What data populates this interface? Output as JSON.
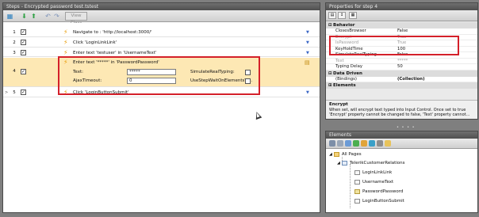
{
  "steps_panel": {
    "title": "Steps - Encrypted password test.tstest",
    "toolbar": {
      "view_class_label": "View Class"
    },
    "rows": [
      {
        "num": "1",
        "desc": "Navigate to : 'http://localhost:3000/'"
      },
      {
        "num": "2",
        "desc": "Click 'LoginLinkLink'"
      },
      {
        "num": "3",
        "desc": "Enter text 'testuser' in 'UsernameText'"
      },
      {
        "num": "4",
        "desc": "Enter text '*****' in 'PasswordPassword'"
      },
      {
        "num": "5",
        "desc": "Click 'LoginButtonSubmit'"
      }
    ],
    "expanded": {
      "text_label": "Text:",
      "text_value": "*****",
      "ajax_label": "AjaxTimeout:",
      "ajax_value": "0",
      "simulate_label": "SimulateRealTyping:",
      "use_step_label": "UseStepWaitOnElementsTi..."
    }
  },
  "properties_panel": {
    "title": "Properties for step 4",
    "categories": {
      "behavior": "Behavior",
      "data_driven": "Data Driven",
      "elements": "Elements"
    },
    "behavior_rows": [
      {
        "name": "ClosesBrowser",
        "value": "False",
        "dim": false
      },
      {
        "name": "Encrypt",
        "value": "True",
        "dim": true
      },
      {
        "name": "IsPassword",
        "value": "True",
        "dim": true
      },
      {
        "name": "KeyHoldTime",
        "value": "100",
        "dim": false
      },
      {
        "name": "SimulateRealTyping",
        "value": "False",
        "dim": false
      },
      {
        "name": "Text",
        "value": "*****",
        "dim": true
      },
      {
        "name": "Typing Delay",
        "value": "50",
        "dim": false
      }
    ],
    "data_driven_rows": [
      {
        "name": "(Bindings)",
        "value": "(Collection)"
      }
    ],
    "description_title": "Encrypt",
    "description_text": "When set, will encrypt text typed into Input Control. Once set to true 'Encrypt' property cannot be changed to false, 'Text' property cannot..."
  },
  "elements_panel": {
    "title": "Elements",
    "tree": {
      "root": "All Pages",
      "page": "TelerikCustomerRelations",
      "children": [
        "LoginLinkLink",
        "UsernameText",
        "PasswordPassword",
        "LoginButtonSubmit"
      ]
    }
  },
  "colors": {
    "highlight_red": "#d4202a",
    "expanded_row": "#fde8b4",
    "action_bolt": "#e89a00"
  }
}
